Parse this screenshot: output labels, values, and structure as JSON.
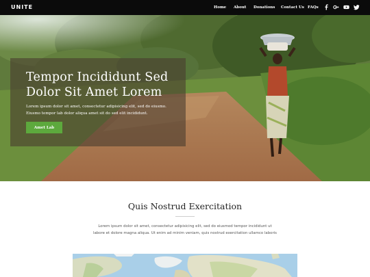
{
  "brand": "UNITE",
  "nav": {
    "items": [
      "Home",
      "About",
      "Donations",
      "Contact Us",
      "FAQs"
    ],
    "social_icons": [
      "facebook-icon",
      "google-plus-icon",
      "youtube-icon",
      "twitter-icon"
    ],
    "social_glyphs": [
      "f",
      "g+",
      "▶",
      "t"
    ]
  },
  "hero": {
    "title_line1": "Tempor Incididunt Sed",
    "title_line2": "Dolor Sit Amet Lorem",
    "text_line1": "Lorem ipsum dolor sit amet, consectetur adipisicing elit, sed do eiusmo.",
    "text_line2": "Eiusmo tempor lab dolor aliqua amet sit do sed elit incididunt.",
    "button_label": "Amet Lab"
  },
  "section": {
    "title": "Quis Nostrud Exercitation",
    "text_line1": "Lorem ipsum dolor sit amet, consectetur adipisicing elit, sed do eiusmod tempor incididunt ut",
    "text_line2": "labore et dolore magna aliqua. Ut enim ad minim veniam, quis nostrud exercitation ullamco laboris"
  },
  "colors": {
    "navbar": "#0b0b0b",
    "accent_green": "#5da93d",
    "hero_overlay": "rgba(74,60,46,0.6)"
  }
}
